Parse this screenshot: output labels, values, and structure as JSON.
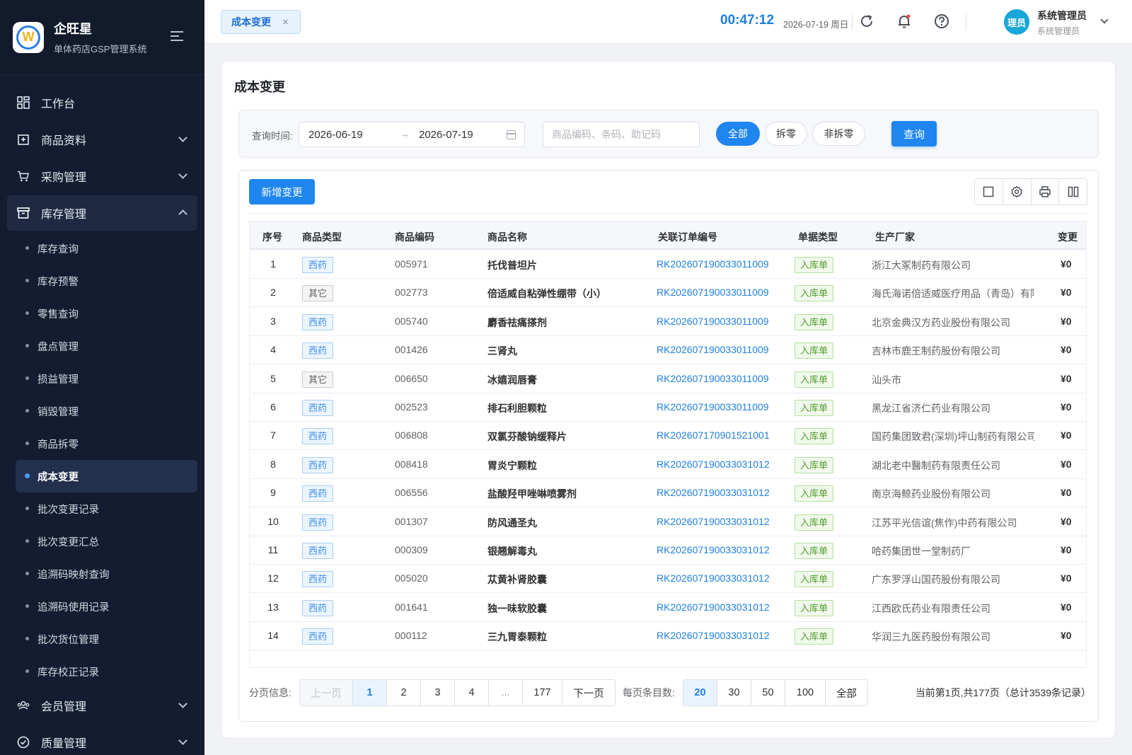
{
  "brand": {
    "title": "企旺星",
    "subtitle": "单体药店GSP管理系统",
    "logo_letter": "W"
  },
  "menu": {
    "workbench": "工作台",
    "goods": "商品资料",
    "purchase": "采购管理",
    "inventory": "库存管理",
    "inventory_items": [
      "库存查询",
      "库存预警",
      "零售查询",
      "盘点管理",
      "损益管理",
      "销毁管理",
      "商品拆零",
      "成本变更",
      "批次变更记录",
      "批次变更汇总",
      "追溯码映射查询",
      "追溯码使用记录",
      "批次货位管理",
      "库存校正记录"
    ],
    "active_item": "成本变更",
    "member": "会员管理",
    "quality": "质量管理"
  },
  "topbar": {
    "tab_label": "成本变更",
    "tab_close": "×",
    "clock": "00:47:12",
    "date": "2026-07-19 周日",
    "avatar_text": "理员",
    "user_name": "系统管理员",
    "user_role": "系统管理员"
  },
  "page": {
    "title": "成本变更"
  },
  "filter": {
    "time_label": "查询时间:",
    "date_start": "2026-06-19",
    "date_arrow": "→",
    "date_end": "2026-07-19",
    "search_placeholder": "商品编码、条码、助记码",
    "seg_all": "全部",
    "seg_split": "拆零",
    "seg_nonsplit": "非拆零",
    "query_label": "查询"
  },
  "toolbar": {
    "add_label": "新增变更"
  },
  "table": {
    "headers": [
      "序号",
      "商品类型",
      "商品编码",
      "商品名称",
      "关联订单编号",
      "单据类型",
      "生产厂家",
      "变更"
    ],
    "rows": [
      {
        "idx": "1",
        "type": "西药",
        "code": "005971",
        "name": "托伐普坦片",
        "order": "RK202607190033011009",
        "btype": "入库单",
        "mfr": "浙江大冢制药有限公司",
        "amt": "¥0"
      },
      {
        "idx": "2",
        "type": "其它",
        "code": "002773",
        "name": "倍适威自粘弹性绷带（小）",
        "order": "RK202607190033011009",
        "btype": "入库单",
        "mfr": "海氏海诺倍适威医疗用品（青岛）有限",
        "amt": "¥0"
      },
      {
        "idx": "3",
        "type": "西药",
        "code": "005740",
        "name": "麝香祛痛搽剂",
        "order": "RK202607190033011009",
        "btype": "入库单",
        "mfr": "北京金典汉方药业股份有限公司",
        "amt": "¥0"
      },
      {
        "idx": "4",
        "type": "西药",
        "code": "001426",
        "name": "三肾丸",
        "order": "RK202607190033011009",
        "btype": "入库单",
        "mfr": "吉林市鹿王制药股份有限公司",
        "amt": "¥0"
      },
      {
        "idx": "5",
        "type": "其它",
        "code": "006650",
        "name": "冰嬉润唇膏",
        "order": "RK202607190033011009",
        "btype": "入库单",
        "mfr": "汕头市",
        "amt": "¥0"
      },
      {
        "idx": "6",
        "type": "西药",
        "code": "002523",
        "name": "排石利胆颗粒",
        "order": "RK202607190033011009",
        "btype": "入库单",
        "mfr": "黑龙江省济仁药业有限公司",
        "amt": "¥0"
      },
      {
        "idx": "7",
        "type": "西药",
        "code": "006808",
        "name": "双氯芬酸钠缓释片",
        "order": "RK202607170901521001",
        "btype": "入库单",
        "mfr": "国药集团致君(深圳)坪山制药有限公司",
        "amt": "¥0"
      },
      {
        "idx": "8",
        "type": "西药",
        "code": "008418",
        "name": "胃炎宁颗粒",
        "order": "RK202607190033031012",
        "btype": "入库单",
        "mfr": "湖北老中醫制药有限责任公司",
        "amt": "¥0"
      },
      {
        "idx": "9",
        "type": "西药",
        "code": "006556",
        "name": "盐酸羟甲唑啉喷雾剂",
        "order": "RK202607190033031012",
        "btype": "入库单",
        "mfr": "南京海鲸药业股份有限公司",
        "amt": "¥0"
      },
      {
        "idx": "10",
        "type": "西药",
        "code": "001307",
        "name": "防风通圣丸",
        "order": "RK202607190033031012",
        "btype": "入库单",
        "mfr": "江苏平光信谊(焦作)中药有限公司",
        "amt": "¥0"
      },
      {
        "idx": "11",
        "type": "西药",
        "code": "000309",
        "name": "银翘解毒丸",
        "order": "RK202607190033031012",
        "btype": "入库单",
        "mfr": "哈药集团世一堂制药厂",
        "amt": "¥0"
      },
      {
        "idx": "12",
        "type": "西药",
        "code": "005020",
        "name": "苁黄补肾胶囊",
        "order": "RK202607190033031012",
        "btype": "入库单",
        "mfr": "广东罗浮山国药股份有限公司",
        "amt": "¥0"
      },
      {
        "idx": "13",
        "type": "西药",
        "code": "001641",
        "name": "独一味软胶囊",
        "order": "RK202607190033031012",
        "btype": "入库单",
        "mfr": "江西欧氏药业有限责任公司",
        "amt": "¥0"
      },
      {
        "idx": "14",
        "type": "西药",
        "code": "000112",
        "name": "三九胃泰颗粒",
        "order": "RK202607190033031012",
        "btype": "入库单",
        "mfr": "华润三九医药股份有限公司",
        "amt": "¥0"
      }
    ]
  },
  "pager": {
    "label": "分页信息:",
    "prev": "上一页",
    "pages": [
      "1",
      "2",
      "3",
      "4",
      "...",
      "177"
    ],
    "next": "下一页",
    "size_label": "每页条目数:",
    "sizes": [
      "20",
      "30",
      "50",
      "100",
      "全部"
    ],
    "summary": "当前第1页,共177页（总计3539条记录）"
  },
  "colors": {
    "primary": "#1f86f0",
    "sidebar_bg": "#131c30",
    "link": "#1f7fe0",
    "success_tag": "#529b2e"
  }
}
